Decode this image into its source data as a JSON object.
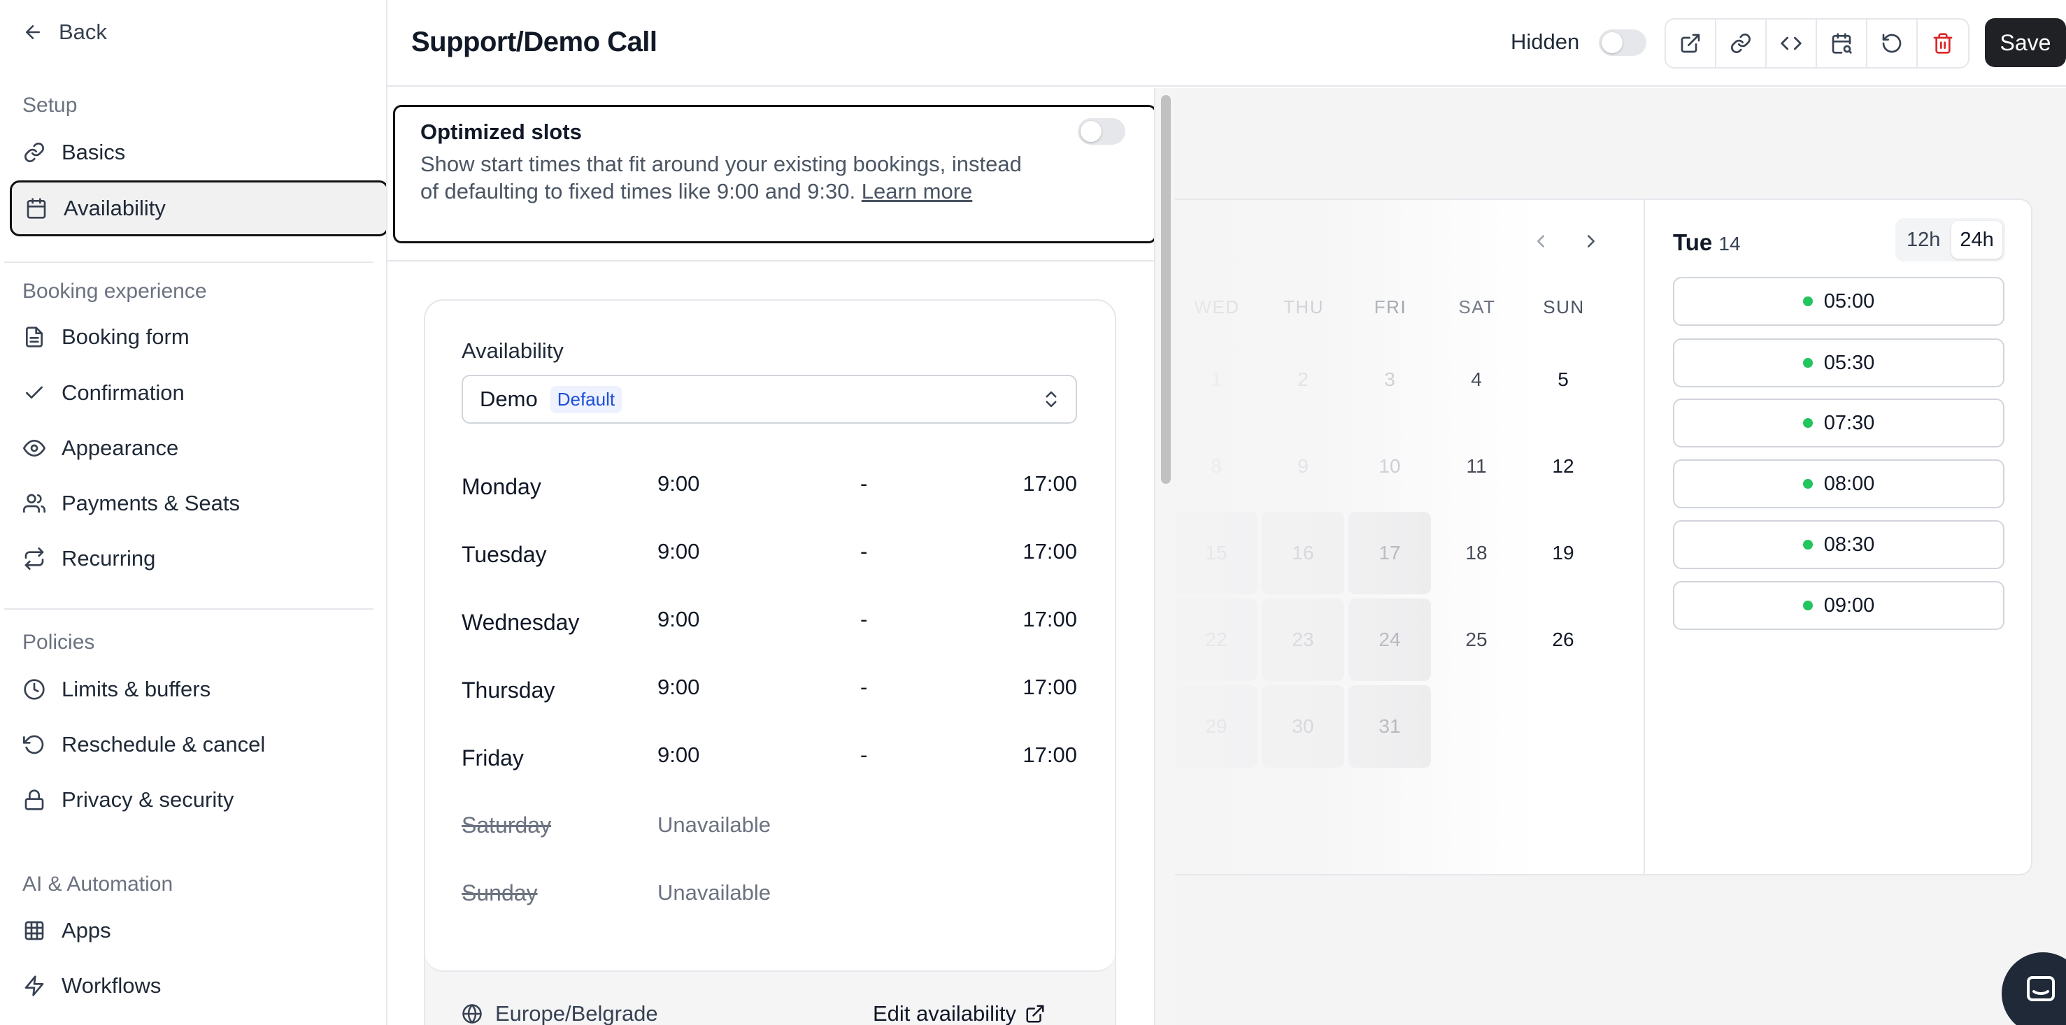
{
  "sidebar": {
    "back_label": "Back",
    "sections": [
      {
        "title": "Setup",
        "items": [
          {
            "label": "Basics",
            "icon": "link-icon"
          },
          {
            "label": "Availability",
            "icon": "calendar-icon",
            "active": true
          }
        ]
      },
      {
        "title": "Booking experience",
        "items": [
          {
            "label": "Booking form",
            "icon": "document-icon"
          },
          {
            "label": "Confirmation",
            "icon": "check-icon"
          },
          {
            "label": "Appearance",
            "icon": "eye-icon"
          },
          {
            "label": "Payments & Seats",
            "icon": "users-icon"
          },
          {
            "label": "Recurring",
            "icon": "repeat-icon"
          }
        ]
      },
      {
        "title": "Policies",
        "items": [
          {
            "label": "Limits & buffers",
            "icon": "clock-icon"
          },
          {
            "label": "Reschedule & cancel",
            "icon": "rotate-icon"
          },
          {
            "label": "Privacy & security",
            "icon": "lock-icon"
          }
        ]
      },
      {
        "title": "AI & Automation",
        "items": [
          {
            "label": "Apps",
            "icon": "grid-icon"
          },
          {
            "label": "Workflows",
            "icon": "zap-icon"
          }
        ]
      }
    ]
  },
  "header": {
    "title": "Support/Demo Call",
    "hidden_label": "Hidden",
    "hidden_on": false,
    "save_label": "Save",
    "toolbar_icons": [
      "external-link-icon",
      "link-icon",
      "code-icon",
      "calendar-search-icon",
      "reset-icon",
      "trash-icon"
    ]
  },
  "optimized": {
    "title": "Optimized slots",
    "description": "Show start times that fit around your existing bookings, instead of defaulting to fixed times like 9:00 and 9:30.",
    "learn_more": "Learn more",
    "enabled": false
  },
  "availability": {
    "label": "Availability",
    "schedule": "Demo",
    "badge": "Default",
    "days": [
      {
        "day": "Monday",
        "start": "9:00",
        "sep": "-",
        "end": "17:00"
      },
      {
        "day": "Tuesday",
        "start": "9:00",
        "sep": "-",
        "end": "17:00"
      },
      {
        "day": "Wednesday",
        "start": "9:00",
        "sep": "-",
        "end": "17:00"
      },
      {
        "day": "Thursday",
        "start": "9:00",
        "sep": "-",
        "end": "17:00"
      },
      {
        "day": "Friday",
        "start": "9:00",
        "sep": "-",
        "end": "17:00"
      },
      {
        "day": "Saturday",
        "status": "Unavailable"
      },
      {
        "day": "Sunday",
        "status": "Unavailable"
      }
    ],
    "timezone": "Europe/Belgrade",
    "edit_label": "Edit availability"
  },
  "preview": {
    "weekdays": [
      "WED",
      "THU",
      "FRI",
      "SAT",
      "SUN"
    ],
    "rows": [
      [
        "1",
        "2",
        "3",
        "4",
        "5"
      ],
      [
        "8",
        "9",
        "10",
        "11",
        "12"
      ],
      [
        "15",
        "16",
        "17",
        "18",
        "19"
      ],
      [
        "22",
        "23",
        "24",
        "25",
        "26"
      ],
      [
        "29",
        "30",
        "31",
        "",
        ""
      ]
    ],
    "selected_day": "Tue",
    "selected_num": "14",
    "format_12": "12h",
    "format_24": "24h",
    "active_format": "24h",
    "slots": [
      "05:00",
      "05:30",
      "07:30",
      "08:00",
      "08:30",
      "09:00"
    ],
    "slot_color": "#22c55e"
  }
}
